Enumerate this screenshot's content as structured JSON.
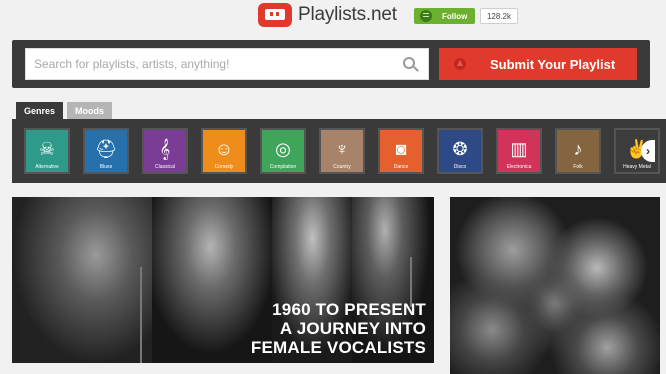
{
  "header": {
    "site_name": "Playlists.net",
    "follow_label": "Follow",
    "follow_count": "128.2k"
  },
  "search": {
    "placeholder": "Search for playlists, artists, anything!",
    "submit_label": "Submit Your Playlist"
  },
  "tabs": [
    {
      "label": "Genres",
      "active": true
    },
    {
      "label": "Moods",
      "active": false
    }
  ],
  "genres": [
    {
      "label": "Alternative",
      "color": "#2e9a8a",
      "icon": "skull-icon",
      "glyph": "☠"
    },
    {
      "label": "Blues",
      "color": "#2670ab",
      "icon": "hat-icon",
      "glyph": "⛑"
    },
    {
      "label": "Classical",
      "color": "#7a3c94",
      "icon": "treble-clef-icon",
      "glyph": "𝄞"
    },
    {
      "label": "Comedy",
      "color": "#ef8d1c",
      "icon": "theater-mask-icon",
      "glyph": "☺"
    },
    {
      "label": "Compilation",
      "color": "#3ea55a",
      "icon": "cd-icon",
      "glyph": "◎"
    },
    {
      "label": "Country",
      "color": "#a9826a",
      "icon": "cactus-icon",
      "glyph": "♆"
    },
    {
      "label": "Dance",
      "color": "#e4602c",
      "icon": "speaker-icon",
      "glyph": "◙"
    },
    {
      "label": "Disco",
      "color": "#2d4a86",
      "icon": "disco-ball-icon",
      "glyph": "❂"
    },
    {
      "label": "Electronica",
      "color": "#d2335a",
      "icon": "equalizer-icon",
      "glyph": "▥"
    },
    {
      "label": "Folk",
      "color": "#85653f",
      "icon": "mandolin-icon",
      "glyph": "♪"
    },
    {
      "label": "Heavy Metal",
      "color": "#3c3c3c",
      "icon": "rock-hand-icon",
      "glyph": "✌"
    }
  ],
  "featured": {
    "caption_lines": [
      "1960 TO PRESENT",
      "A JOURNEY INTO",
      "FEMALE VOCALISTS"
    ]
  },
  "colors": {
    "brand_red": "#e03a2c",
    "follow_green": "#6bb12f",
    "dark_panel": "#3a3a3a"
  }
}
